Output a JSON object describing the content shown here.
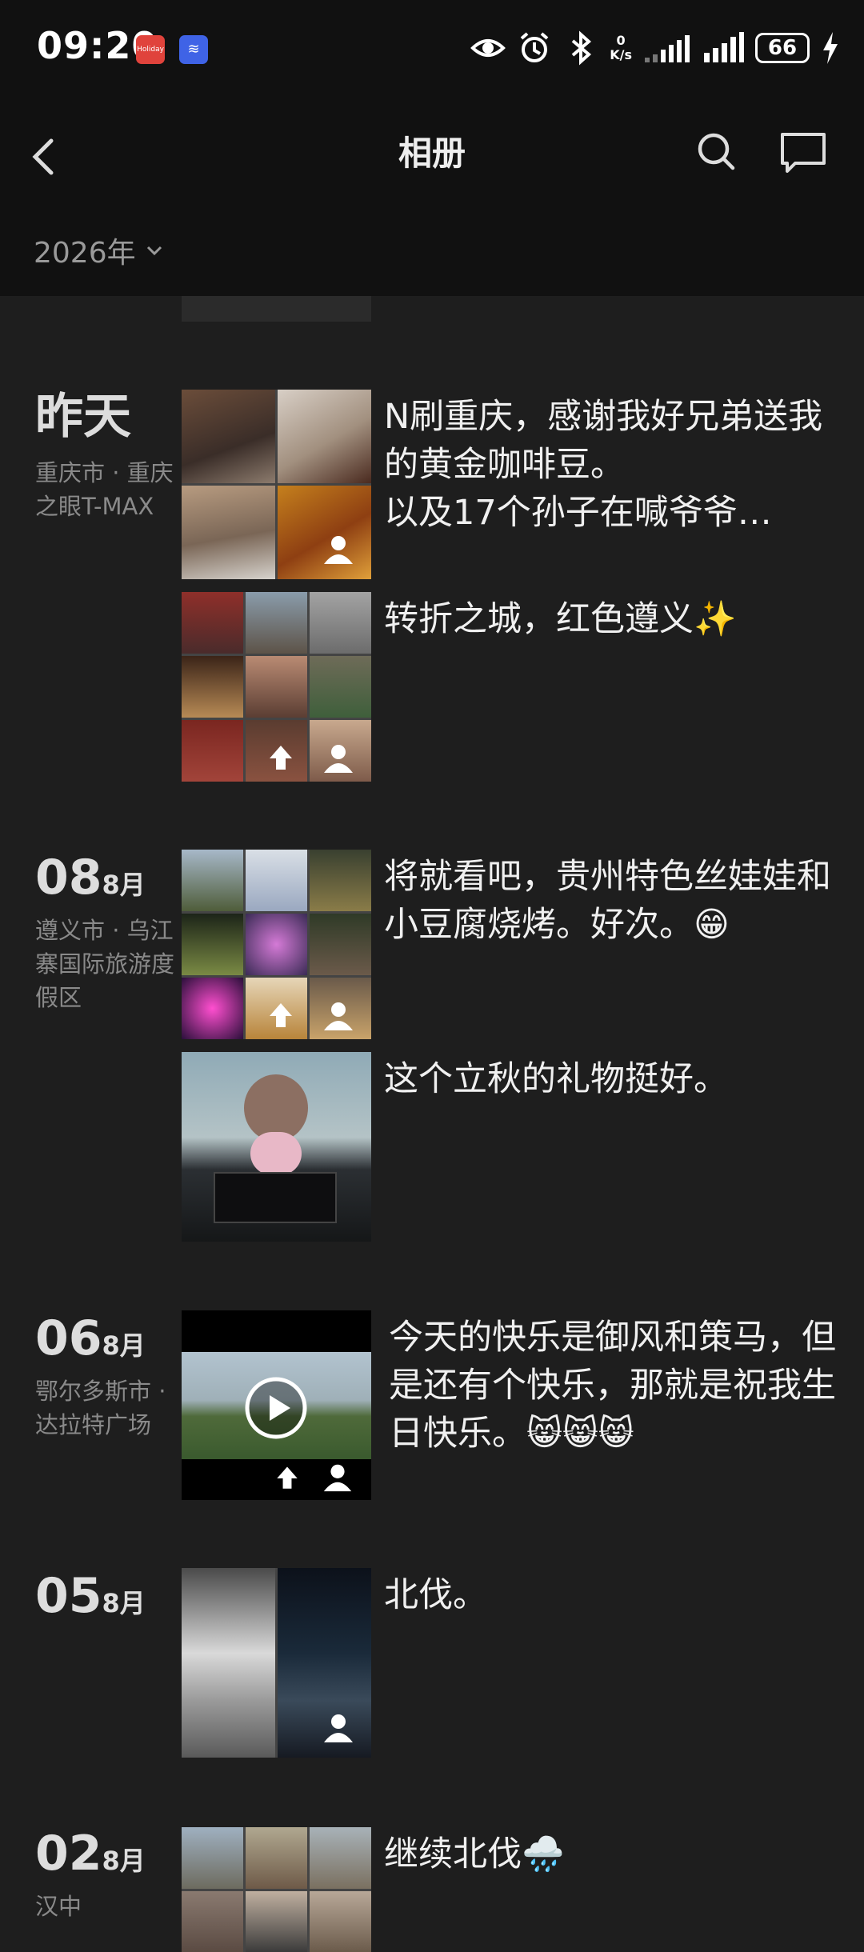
{
  "status": {
    "time": "09:20",
    "app1": "Holiday",
    "app2": "≋",
    "speed_top": "0",
    "speed_unit": "K/s",
    "battery": "66"
  },
  "nav": {
    "title": "相册",
    "year": "2026年"
  },
  "colors": {
    "bg": "#1e1e1e",
    "bar": "#111111",
    "text": "#f0f0f0",
    "muted": "#8a8a8a"
  },
  "entries": [
    {
      "day": "昨天",
      "month": "",
      "location": "重庆市 · 重庆之眼T-MAX",
      "posts": [
        {
          "caption": "N刷重庆，感谢我好兄弟送我的黄金咖啡豆。\n以及17个孙子在喊爷爷…"
        },
        {
          "caption": "转折之城，红色遵义✨"
        }
      ]
    },
    {
      "day": "08",
      "month": "8月",
      "location": "遵义市 · 乌江寨国际旅游度假区",
      "posts": [
        {
          "caption": "将就看吧，贵州特色丝娃娃和小豆腐烧烤。好次。😁"
        },
        {
          "caption": "这个立秋的礼物挺好。"
        }
      ]
    },
    {
      "day": "06",
      "month": "8月",
      "location": "鄂尔多斯市 · 达拉特广场",
      "posts": [
        {
          "caption": "今天的快乐是御风和策马，但是还有个快乐，那就是祝我生日快乐。😸😸😸"
        }
      ]
    },
    {
      "day": "05",
      "month": "8月",
      "location": "",
      "posts": [
        {
          "caption": "北伐。"
        }
      ]
    },
    {
      "day": "02",
      "month": "8月",
      "location": "汉中",
      "posts": [
        {
          "caption": "继续北伐🌧️"
        }
      ]
    }
  ]
}
